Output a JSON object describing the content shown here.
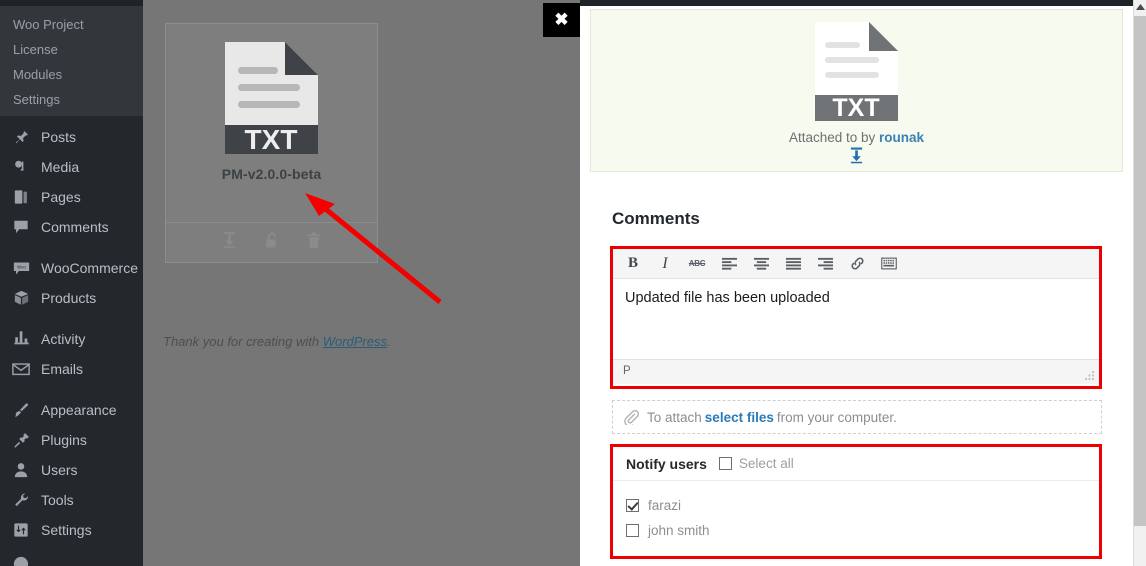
{
  "sidebar": {
    "submenu": [
      {
        "label": "",
        "partial": true
      },
      {
        "label": "Woo Project"
      },
      {
        "label": "License"
      },
      {
        "label": "Modules"
      },
      {
        "label": "Settings"
      }
    ],
    "groups": [
      {
        "items": [
          {
            "label": "Posts",
            "icon": "pin-icon"
          },
          {
            "label": "Media",
            "icon": "media-icon"
          },
          {
            "label": "Pages",
            "icon": "pages-icon"
          },
          {
            "label": "Comments",
            "icon": "comment-bubble-icon"
          }
        ]
      },
      {
        "items": [
          {
            "label": "WooCommerce",
            "icon": "woo-icon"
          },
          {
            "label": "Products",
            "icon": "box-icon"
          }
        ]
      },
      {
        "items": [
          {
            "label": "Activity",
            "icon": "activity-icon"
          },
          {
            "label": "Emails",
            "icon": "envelope-icon"
          }
        ]
      },
      {
        "items": [
          {
            "label": "Appearance",
            "icon": "brush-icon"
          },
          {
            "label": "Plugins",
            "icon": "plug-icon"
          },
          {
            "label": "Users",
            "icon": "user-icon"
          },
          {
            "label": "Tools",
            "icon": "wrench-icon"
          },
          {
            "label": "Settings",
            "icon": "settings-icon"
          }
        ]
      }
    ]
  },
  "file_card": {
    "file_name": "PM-v2.0.0-beta",
    "file_type_label": "TXT",
    "actions": [
      {
        "name": "download-icon"
      },
      {
        "name": "unlock-icon"
      },
      {
        "name": "trash-icon"
      }
    ]
  },
  "footer": {
    "thank_you_prefix": "Thank you for creating with ",
    "link_label": "WordPress",
    "suffix": "."
  },
  "close_button": {
    "label": "✖"
  },
  "attachment": {
    "file_type_label": "TXT",
    "attached_prefix": "Attached to by ",
    "attached_user": "rounak",
    "download_icon": "download-icon"
  },
  "comments": {
    "title": "Comments",
    "editor": {
      "toolbar": [
        {
          "name": "bold-button",
          "label": "B"
        },
        {
          "name": "italic-button",
          "label": "I"
        },
        {
          "name": "strikethrough-button",
          "label": "ABC"
        },
        {
          "name": "align-left-button",
          "label": ""
        },
        {
          "name": "align-center-button",
          "label": ""
        },
        {
          "name": "justify-button",
          "label": ""
        },
        {
          "name": "align-right-button",
          "label": ""
        },
        {
          "name": "link-button",
          "label": ""
        },
        {
          "name": "keyboard-shortcuts-button",
          "label": ""
        }
      ],
      "content": "Updated file has been uploaded",
      "status_path": "P"
    },
    "attach_row": {
      "prefix": "To attach ",
      "link_label": "select files",
      "suffix": " from your computer."
    },
    "notify": {
      "title": "Notify users",
      "select_all_label": "Select all",
      "select_all_checked": false,
      "users": [
        {
          "name": "farazi",
          "checked": true
        },
        {
          "name": "john smith",
          "checked": false
        }
      ]
    }
  },
  "colors": {
    "sidebar_bg": "#23282d",
    "submenu_bg": "#32373c",
    "overlay": "#767676",
    "annotation_red": "#ee0000",
    "link_blue": "#2b7bb9",
    "hero_bg": "#f7fbef"
  }
}
